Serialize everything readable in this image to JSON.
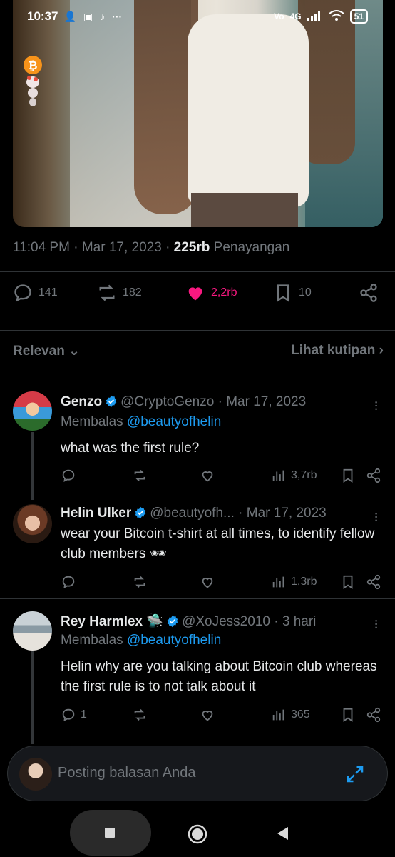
{
  "status_bar": {
    "time": "10:37",
    "network": "4G",
    "battery": "51"
  },
  "tweet": {
    "time": "11:04 PM",
    "date": "Mar 17, 2023",
    "views_count": "225rb",
    "views_label": "Penayangan",
    "replies": "141",
    "retweets": "182",
    "likes": "2,2rb",
    "bookmarks": "10",
    "like_color": "#f91880"
  },
  "sort": {
    "relevance_label": "Relevan",
    "quotes_label": "Lihat kutipan"
  },
  "replies": [
    {
      "name": "Genzo",
      "handle": "@CryptoGenzo",
      "date": "Mar 17, 2023",
      "replying_prefix": "Membalas",
      "replying_to": "@beautyofhelin",
      "text": "what was the first rule?",
      "reply_count": "",
      "views": "3,7rb"
    },
    {
      "name": "Helin Ulker",
      "handle": "@beautyofh...",
      "date": "Mar 17, 2023",
      "text": "wear your Bitcoin t-shirt at all times, to identify fellow club members 🕶",
      "reply_count": "",
      "views": "1,3rb"
    },
    {
      "name": "Rey Harmlex",
      "emoji": "🛸",
      "handle": "@XoJess2010",
      "date": "3 hari",
      "replying_prefix": "Membalas",
      "replying_to": "@beautyofhelin",
      "text": "Helin why are you talking about Bitcoin club whereas the first rule is to not talk about it",
      "reply_count": "1",
      "views": "365"
    }
  ],
  "composer": {
    "placeholder": "Posting balasan Anda"
  },
  "colors": {
    "accent": "#1d9bf0",
    "muted": "#71767b",
    "text": "#e7e9ea"
  }
}
